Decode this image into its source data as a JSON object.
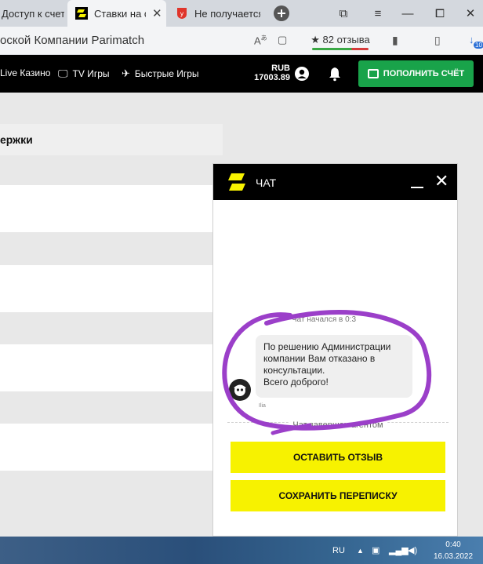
{
  "browser": {
    "tabs": [
      {
        "title": "Доступ к счету",
        "active": false
      },
      {
        "title": "Ставки на с",
        "active": true
      },
      {
        "title": "Не получается",
        "active": false
      }
    ],
    "address": "оской Компании Parimatch",
    "reviews_label": "★ 82 отзыва",
    "extension_badge": "10"
  },
  "site_header": {
    "nav": [
      "Live Казино",
      "TV Игры",
      "Быстрые Игры"
    ],
    "balance_currency": "RUB",
    "balance_amount": "17003.89",
    "deposit_label": "ПОПОЛНИТЬ СЧЁТ"
  },
  "page": {
    "support_title": "ержки"
  },
  "chat": {
    "title": "ЧАТ",
    "started_label": "Чат начался в 0:3",
    "message_lines": [
      "По решению Администрации",
      "компании Вам отказано в",
      "консультации.",
      "Всего доброго!"
    ],
    "agent_name": "Ilia",
    "ended_label": "Чат завершен агентом",
    "review_button": "ОСТАВИТЬ ОТЗЫВ",
    "save_button": "СОХРАНИТЬ ПЕРЕПИСКУ"
  },
  "taskbar": {
    "language": "RU",
    "time": "0:40",
    "date": "16.03.2022"
  },
  "colors": {
    "accent_green": "#19a34a",
    "chat_button_yellow": "#f7f200",
    "annotation_purple": "#9b3fc9"
  }
}
